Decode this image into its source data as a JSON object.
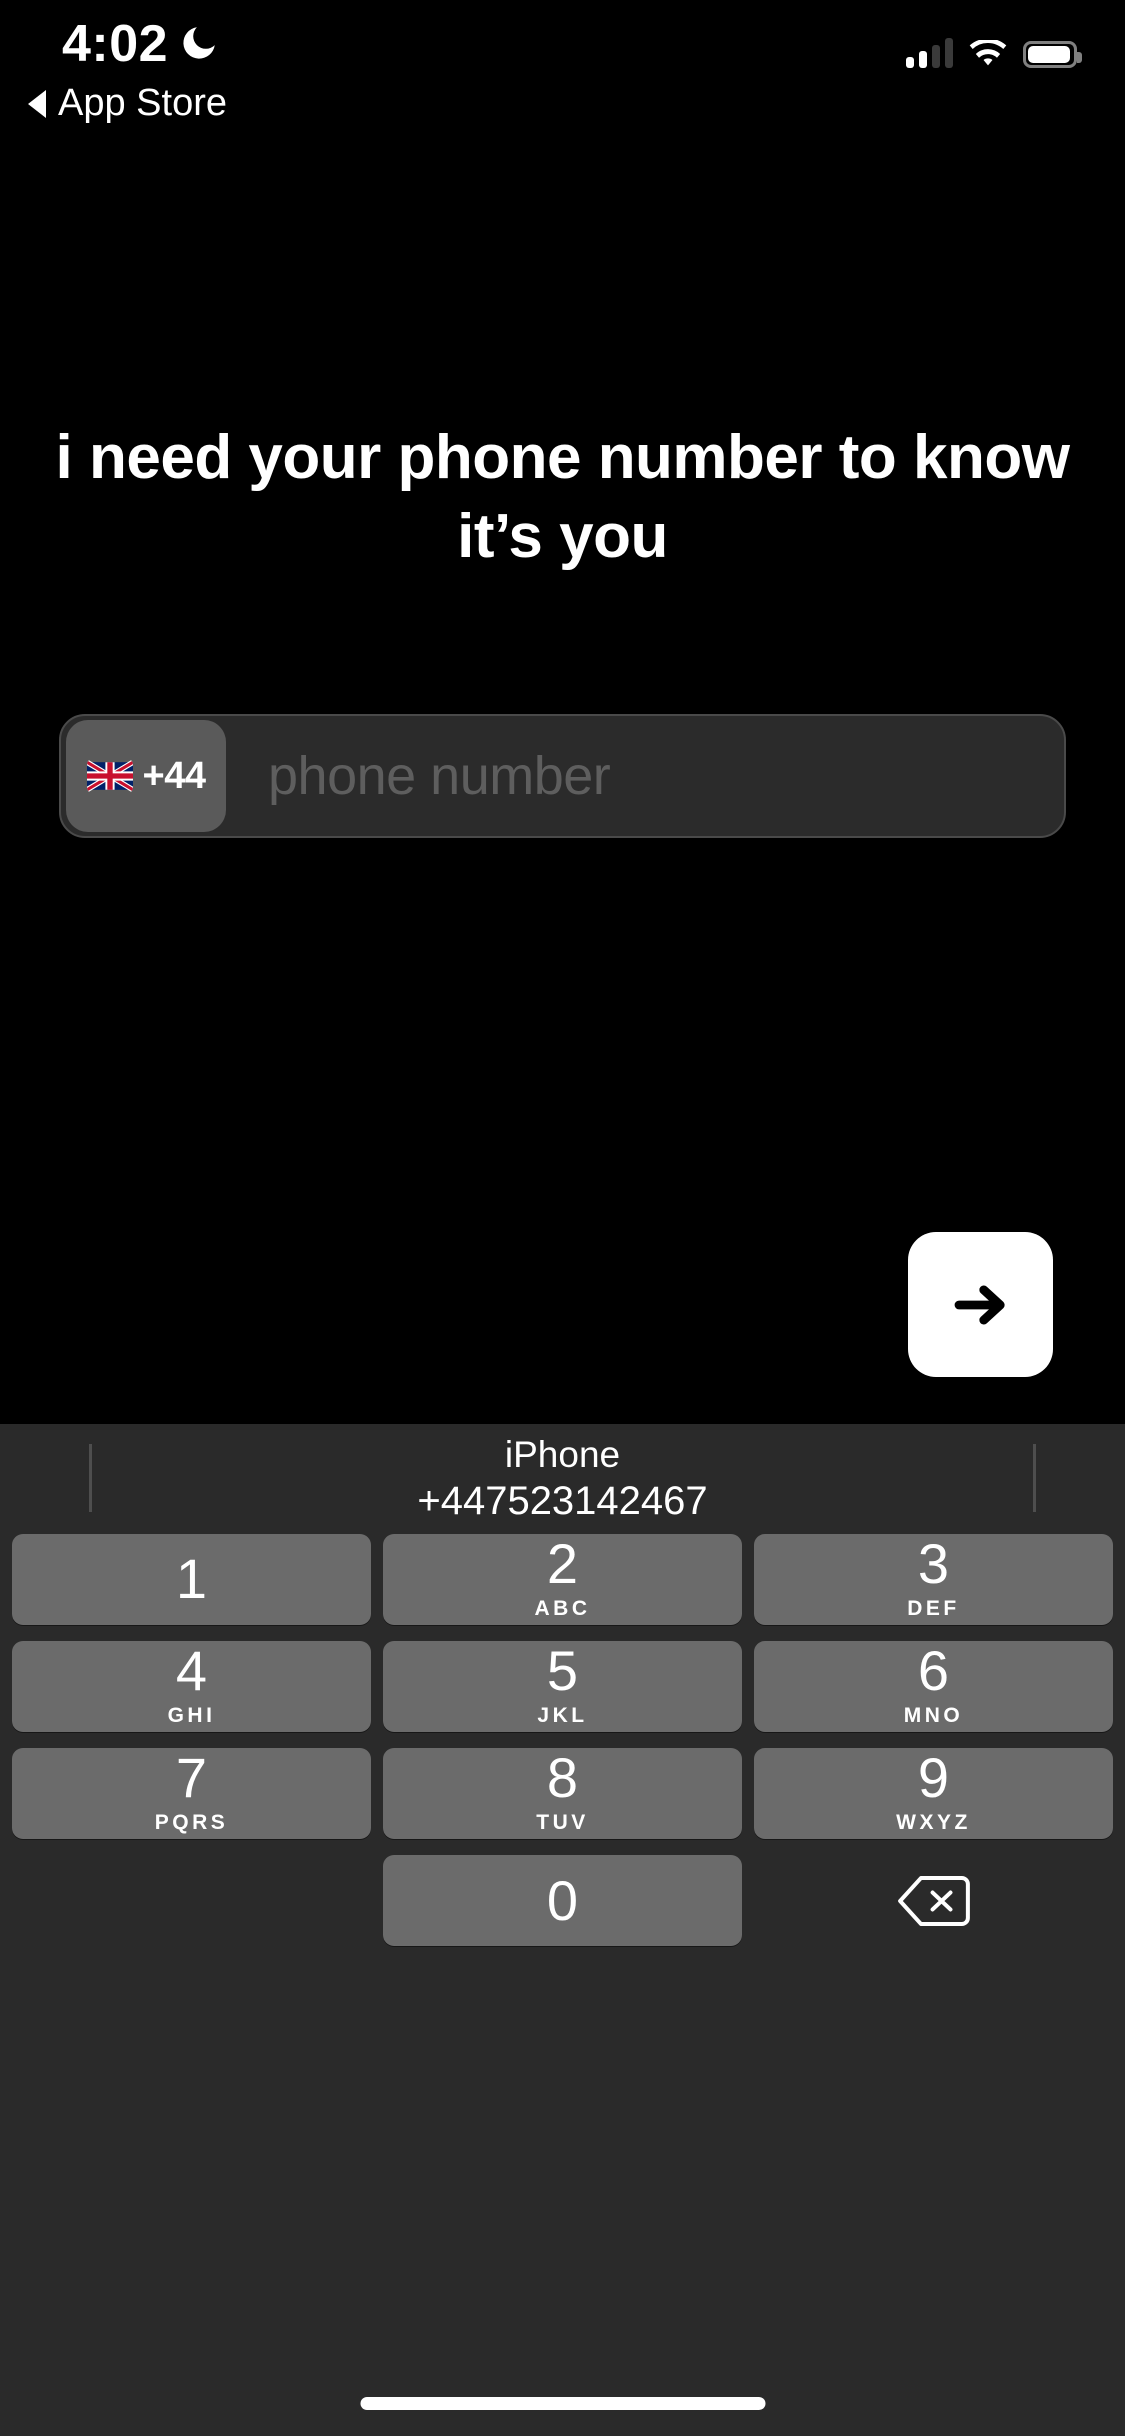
{
  "status_bar": {
    "time": "4:02",
    "dnd_icon": "crescent-moon-icon",
    "cellular_icon": "signal-bars-icon",
    "cellular_bars_filled": 2,
    "cellular_bars_total": 4,
    "wifi_icon": "wifi-icon",
    "battery_icon": "battery-icon",
    "battery_level_pct": 85
  },
  "back_link": {
    "icon": "back-triangle-icon",
    "label": "App Store"
  },
  "main": {
    "headline": "i need your phone number to know it’s you",
    "phone_input": {
      "country_code": "+44",
      "flag_icon": "uk-flag-icon",
      "placeholder": "phone number",
      "value": ""
    },
    "submit_button": {
      "icon": "arrow-right-icon",
      "label": ""
    }
  },
  "keyboard": {
    "autofill": {
      "source_label": "iPhone",
      "number": "+447523142467"
    },
    "rows": [
      [
        {
          "digit": "1",
          "letters": ""
        },
        {
          "digit": "2",
          "letters": "ABC"
        },
        {
          "digit": "3",
          "letters": "DEF"
        }
      ],
      [
        {
          "digit": "4",
          "letters": "GHI"
        },
        {
          "digit": "5",
          "letters": "JKL"
        },
        {
          "digit": "6",
          "letters": "MNO"
        }
      ],
      [
        {
          "digit": "7",
          "letters": "PQRS"
        },
        {
          "digit": "8",
          "letters": "TUV"
        },
        {
          "digit": "9",
          "letters": "WXYZ"
        }
      ],
      [
        {
          "digit": "",
          "letters": ""
        },
        {
          "digit": "0",
          "letters": ""
        },
        {
          "digit": "delete",
          "letters": ""
        }
      ]
    ],
    "delete_icon": "backspace-delete-icon"
  },
  "home_indicator": "home-indicator",
  "colors": {
    "background": "#000000",
    "keyboard_bg": "#2a2a2a",
    "key_bg": "#6b6b6b",
    "field_bg": "#2b2b2b",
    "chip_bg": "#5a5a5a",
    "placeholder": "#5e5e5e",
    "accent": "#ffffff"
  }
}
